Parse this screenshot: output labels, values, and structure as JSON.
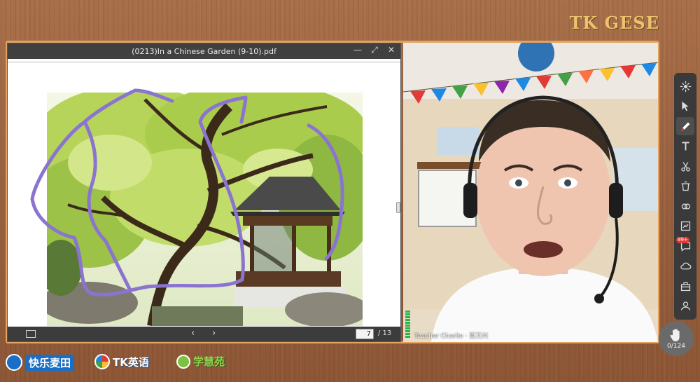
{
  "branding": {
    "top_right": "TK GESE"
  },
  "pdf_viewer": {
    "title": "(0213)In a Chinese Garden (9-10).pdf",
    "window_controls": {
      "minimize": "—",
      "maximize": "⤢",
      "close": "✕"
    },
    "page_input": "7",
    "page_total": "/ 13",
    "nav_prev": "‹",
    "nav_next": "›",
    "annotation_color": "#8a74d0"
  },
  "webcam": {
    "name_label": "Teacher Charlie · 百万兴"
  },
  "toolbar": {
    "tools": [
      "laser-pointer",
      "select",
      "pen",
      "text",
      "scissors",
      "eraser",
      "shapes",
      "slides",
      "chat",
      "cloud",
      "toolbox",
      "people"
    ],
    "active_tool": "pen",
    "chat_badge": "99+"
  },
  "hand_raise": {
    "count": "0/124"
  },
  "logos": {
    "logo1": "快乐麦田",
    "logo2": "TK英语",
    "logo3": "学慧苑"
  },
  "colors": {
    "wood": "#9a6140",
    "frame_border": "#e3a461",
    "brand_gold": "#e9c36e",
    "toolbar_bg": "#3a3a3a"
  }
}
